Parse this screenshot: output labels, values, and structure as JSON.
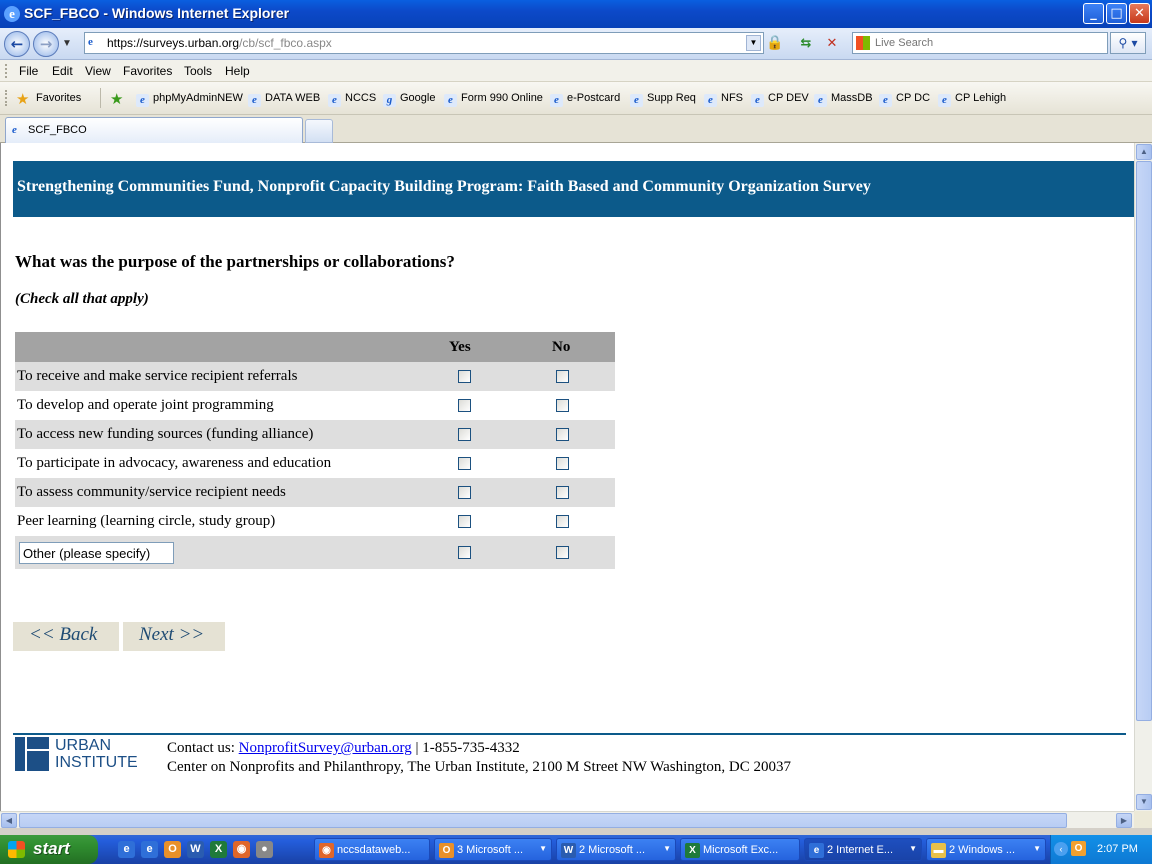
{
  "window": {
    "title": "SCF_FBCO - Windows Internet Explorer",
    "min_label": "_",
    "max_label": "□",
    "close_label": "✕"
  },
  "address": {
    "url_scheme_host": "https://surveys.urban.org",
    "url_path": "/cb/scf_fbco.aspx",
    "search_placeholder": "Live Search"
  },
  "menu": [
    "File",
    "Edit",
    "View",
    "Favorites",
    "Tools",
    "Help"
  ],
  "favorites": {
    "label": "Favorites",
    "links": [
      "phpMyAdminNEW",
      "DATA WEB",
      "NCCS",
      "Google",
      "Form 990 Online",
      "e-Postcard",
      "Supp Req",
      "NFS",
      "CP DEV",
      "MassDB",
      "CP DC",
      "CP Lehigh"
    ]
  },
  "tab": {
    "label": "SCF_FBCO"
  },
  "survey": {
    "banner": "Strengthening Communities Fund, Nonprofit Capacity Building Program: Faith Based and Community Organization Survey",
    "question": "What was the purpose of the partnerships or collaborations?",
    "instruction": "(Check all that apply)",
    "col_yes": "Yes",
    "col_no": "No",
    "rows": [
      "To receive and make service recipient referrals",
      "To develop and operate joint programming",
      "To access new funding sources (funding alliance)",
      "To participate in advocacy, awareness and education",
      "To assess community/service recipient needs",
      "Peer learning (learning circle, study group)"
    ],
    "other_value": "Other (please specify)",
    "back_label": "<< Back",
    "next_label": "Next >>"
  },
  "footer": {
    "logo_line1": "URBAN",
    "logo_line2": "INSTITUTE",
    "contact_prefix": "Contact us: ",
    "contact_email": "NonprofitSurvey@urban.org",
    "contact_phone": " | 1-855-735-4332",
    "address": "Center on Nonprofits and Philanthropy, The Urban Institute, 2100 M Street NW Washington, DC 20037"
  },
  "taskbar": {
    "start_label": "start",
    "tasks": [
      "nccsdataweb...",
      "3 Microsoft ...",
      "2 Microsoft ...",
      "Microsoft Exc...",
      "2 Internet E...",
      "2 Windows ..."
    ],
    "clock": "2:07 PM"
  }
}
